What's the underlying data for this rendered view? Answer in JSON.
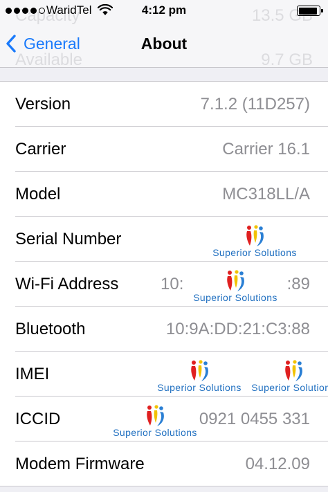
{
  "status_bar": {
    "signal_dots_filled": 4,
    "signal_dots_total": 5,
    "carrier": "WaridTel",
    "time": "4:12 pm",
    "battery_level": 0.9
  },
  "background_rows": {
    "capacity_label": "Capacity",
    "capacity_value": "13.5 GB",
    "available_label": "Available",
    "available_value": "9.7 GB"
  },
  "nav": {
    "back_label": "General",
    "title": "About"
  },
  "rows": {
    "version": {
      "label": "Version",
      "value": "7.1.2 (11D257)"
    },
    "carrier": {
      "label": "Carrier",
      "value": "Carrier 16.1"
    },
    "model": {
      "label": "Model",
      "value": "MC318LL/A"
    },
    "serial": {
      "label": "Serial Number"
    },
    "wifi": {
      "label": "Wi-Fi Address",
      "value_start": "10:",
      "value_end": ":89"
    },
    "bluetooth": {
      "label": "Bluetooth",
      "value": "10:9A:DD:21:C3:88"
    },
    "imei": {
      "label": "IMEI"
    },
    "iccid": {
      "label": "ICCID",
      "value_end": "0921 0455 331"
    },
    "modem": {
      "label": "Modem Firmware",
      "value": "04.12.09"
    }
  },
  "watermark": {
    "text": "Superior Solutions",
    "colors": {
      "text": "#1f6fc0",
      "red": "#e02020",
      "yellow": "#f2c200",
      "blue": "#2a7fd4"
    }
  },
  "colors": {
    "accent": "#1a7afb",
    "value_gray": "#8e8e93",
    "separator": "#c8c7cc",
    "background": "#efeff4"
  }
}
